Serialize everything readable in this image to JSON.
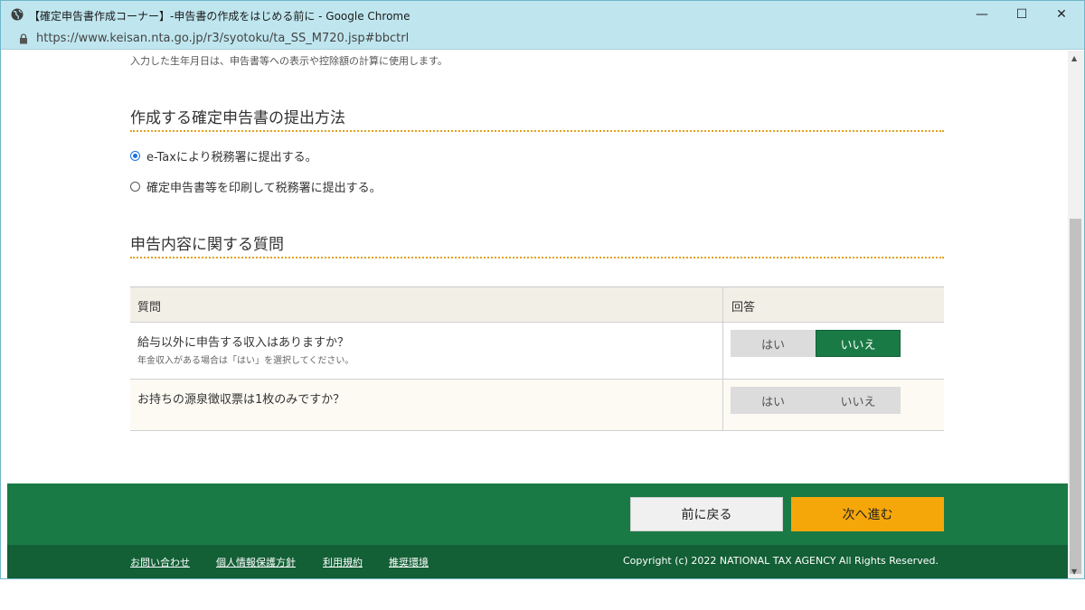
{
  "browser": {
    "title": "【確定申告書作成コーナー】-申告書の作成をはじめる前に - Google Chrome",
    "url": "https://www.keisan.nta.go.jp/r3/syotoku/ta_SS_M720.jsp#bbctrl",
    "minimize": "—",
    "maximize": "☐",
    "close": "✕"
  },
  "note": "入力した生年月日は、申告書等への表示や控除額の計算に使用します。",
  "submission": {
    "heading": "作成する確定申告書の提出方法",
    "options": [
      {
        "label": "e-Taxにより税務署に提出する。",
        "selected": true
      },
      {
        "label": "確定申告書等を印刷して税務署に提出する。",
        "selected": false
      }
    ]
  },
  "questions": {
    "heading": "申告内容に関する質問",
    "col_question": "質問",
    "col_answer": "回答",
    "rows": [
      {
        "text": "給与以外に申告する収入はありますか？",
        "sub": "年金収入がある場合は「はい」を選択してください。",
        "yes": "はい",
        "no": "いいえ",
        "selected": "no"
      },
      {
        "text": "お持ちの源泉徴収票は1枚のみですか？",
        "sub": "",
        "yes": "はい",
        "no": "いいえ",
        "selected": ""
      }
    ]
  },
  "nav": {
    "back": "前に戻る",
    "next": "次へ進む"
  },
  "footer": {
    "links": [
      "お問い合わせ",
      "個人情報保護方針",
      "利用規約",
      "推奨環境"
    ],
    "copyright": "Copyright (c) 2022 NATIONAL TAX AGENCY All Rights Reserved."
  },
  "colors": {
    "accent_green": "#1a7a45",
    "next_orange": "#f5a70a",
    "dotted_line": "#e2a11b",
    "titlebar": "#bfe6ef"
  }
}
